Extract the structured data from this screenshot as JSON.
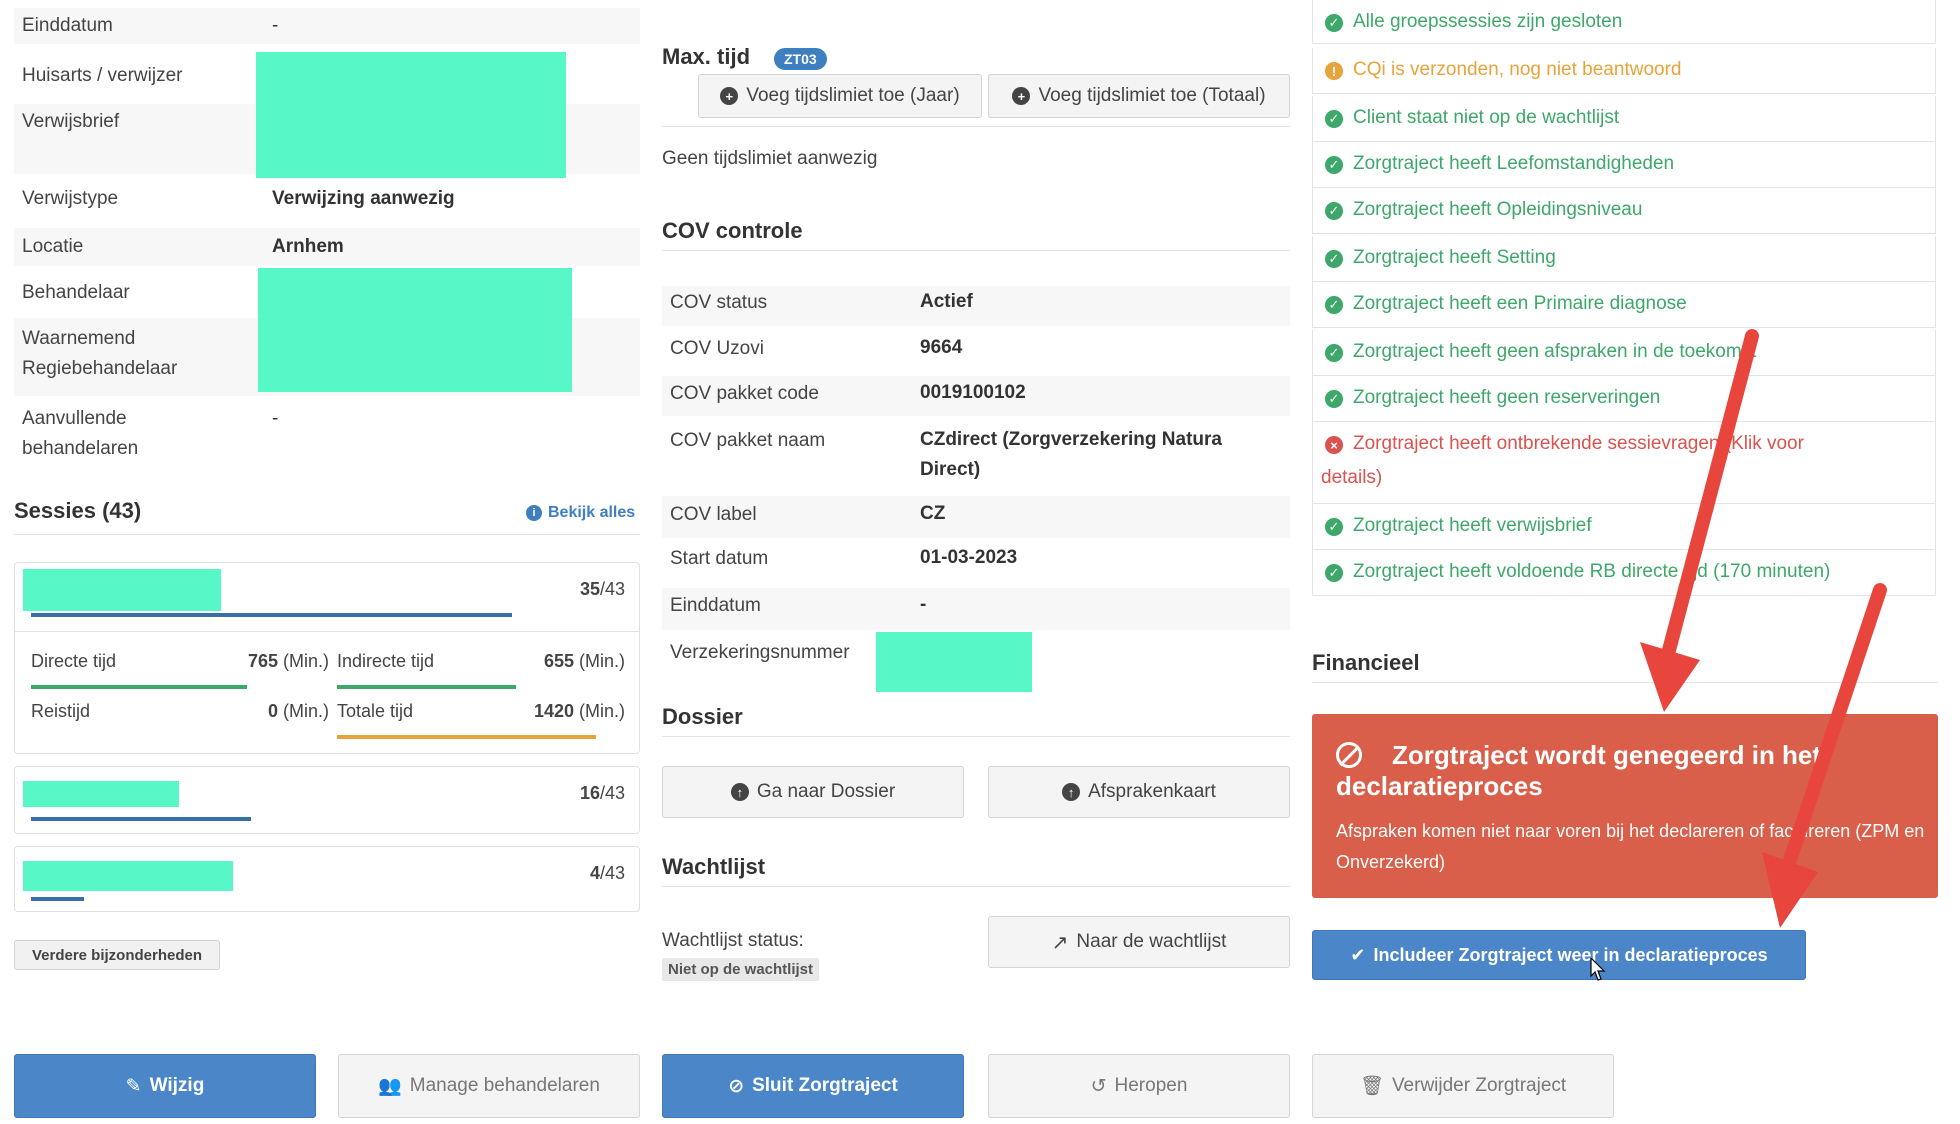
{
  "left": {
    "fields": [
      {
        "label": "Einddatum",
        "value": "-"
      },
      {
        "label": "Huisarts / verwijzer",
        "value": ""
      },
      {
        "label": "Verwijsbrief",
        "value": ""
      },
      {
        "label": "Verwijstype",
        "value": "Verwijzing aanwezig"
      },
      {
        "label": "Locatie",
        "value": "Arnhem"
      },
      {
        "label": "Behandelaar",
        "value": ""
      },
      {
        "label": "Waarnemend Regiebehandelaar",
        "value": ""
      },
      {
        "label": "Aanvullende behandelaren",
        "value": "-"
      }
    ],
    "label_waarnemend_1": "Waarnemend",
    "label_waarnemend_2": "Regiebehandelaar",
    "label_aanvullende_1": "Aanvullende",
    "label_aanvullende_2": "behandelaren",
    "sessions_title": "Sessies (43)",
    "view_all": "Bekijk alles",
    "sessions": [
      {
        "count": "35",
        "total": "/43",
        "progress": 0.81
      },
      {
        "count": "16",
        "total": "/43",
        "progress": 0.37
      },
      {
        "count": "4",
        "total": "/43",
        "progress": 0.09
      }
    ],
    "times": {
      "directe_label": "Directe tijd",
      "directe_val": "765",
      "directe_progress": 0.75,
      "indirecte_label": "Indirecte tijd",
      "indirecte_val": "655",
      "indirecte_progress": 0.62,
      "reis_label": "Reistijd",
      "reis_val": "0",
      "totale_label": "Totale tijd",
      "totale_val": "1420",
      "totale_progress": 0.9,
      "unit": "(Min.)"
    },
    "more_details": "Verdere bijzonderheden"
  },
  "middle": {
    "max_tijd": "Max. tijd",
    "badge": "ZT03",
    "add_year": "Voeg tijdslimiet toe (Jaar)",
    "add_total": "Voeg tijdslimiet toe (Totaal)",
    "no_limit": "Geen tijdslimiet aanwezig",
    "cov_title": "COV controle",
    "cov": [
      {
        "label": "COV status",
        "value": "Actief"
      },
      {
        "label": "COV Uzovi",
        "value": "9664"
      },
      {
        "label": "COV pakket code",
        "value": "0019100102"
      },
      {
        "label": "COV pakket naam",
        "value": "CZdirect (Zorgverzekering Natura"
      },
      {
        "label": "COV label",
        "value": "CZ"
      },
      {
        "label": "Start datum",
        "value": "01-03-2023"
      },
      {
        "label": "Einddatum",
        "value": "-"
      },
      {
        "label": "Verzekeringsnummer",
        "value": ""
      }
    ],
    "cov_pakket_naam_2": "Direct)",
    "dossier_title": "Dossier",
    "dossier_btn": "Ga naar Dossier",
    "afspraken_btn": "Afsprakenkaart",
    "wacht_title": "Wachtlijst",
    "wacht_status_label": "Wachtlijst status:",
    "wacht_status_value": "Niet op de wachtlijst",
    "wacht_btn": "Naar de wachtlijst"
  },
  "right": {
    "checks": [
      {
        "status": "ok",
        "text": "Alle groepssessies zijn gesloten"
      },
      {
        "status": "warn",
        "text": "CQi is verzonden, nog niet beantwoord"
      },
      {
        "status": "ok",
        "text": "Client staat niet op de wachtlijst"
      },
      {
        "status": "ok",
        "text": "Zorgtraject heeft Leefomstandigheden"
      },
      {
        "status": "ok",
        "text": "Zorgtraject heeft Opleidingsniveau"
      },
      {
        "status": "ok",
        "text": "Zorgtraject heeft Setting"
      },
      {
        "status": "ok",
        "text": "Zorgtraject heeft een Primaire diagnose"
      },
      {
        "status": "ok",
        "text": "Zorgtraject heeft geen afspraken in de toekomst"
      },
      {
        "status": "ok",
        "text": "Zorgtraject heeft geen reserveringen"
      },
      {
        "status": "error",
        "text": "Zorgtraject heeft ontbrekende sessievragen (Klik voor"
      },
      {
        "status": "ok",
        "text": "Zorgtraject heeft verwijsbrief"
      },
      {
        "status": "ok",
        "text": "Zorgtraject heeft voldoende RB directe tijd (170 minuten)"
      }
    ],
    "check_error_line2": "details)",
    "fin_title": "Financieel",
    "alert_title": "Zorgtraject wordt genegeerd in het declaratieproces",
    "alert_desc": "Afspraken komen niet naar voren bij het declareren of factureren (ZPM en Onverzekerd)",
    "include_btn": "Includeer Zorgtraject weer in declaratieproces"
  },
  "footer": {
    "wijzig": "Wijzig",
    "manage": "Manage behandelaren",
    "sluit": "Sluit Zorgtraject",
    "heropen": "Heropen",
    "verwijder": "Verwijder Zorgtraject"
  },
  "colors": {
    "primary": "#4a86c8",
    "ok": "#3ea86a",
    "warn": "#e8a33a",
    "error": "#d9534f",
    "alert_bg": "#d95f4a",
    "redaction": "#58f7c8",
    "arrow": "#e8453c"
  }
}
